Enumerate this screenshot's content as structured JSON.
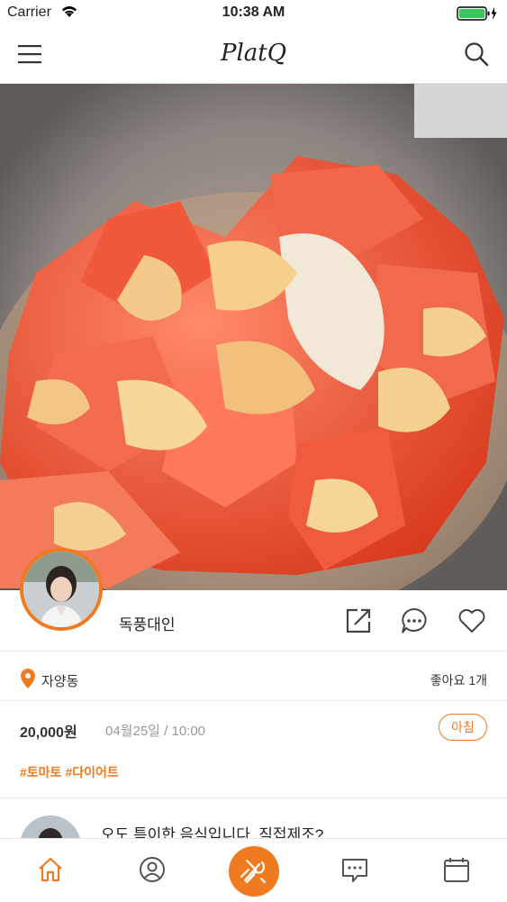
{
  "status_bar": {
    "carrier": "Carrier",
    "time": "10:38 AM"
  },
  "nav": {
    "logo": "PlatQ",
    "menu_icon": "hamburger-menu-icon",
    "search_icon": "search-icon"
  },
  "post": {
    "username": "독풍대인",
    "location": "자양동",
    "likes": "좋아요 1개",
    "price": "20,000원",
    "datetime": "04월25일 / 10:00",
    "meal": "아침",
    "tags": [
      "#토마토",
      "#다이어트"
    ],
    "actions": [
      "share-icon",
      "comment-icon",
      "heart-icon"
    ]
  },
  "comment": {
    "text": "오도 특이한 음식입니다. 직접제조?"
  },
  "tabs": [
    "home-icon",
    "profile-icon",
    "food-icon",
    "message-icon",
    "calendar-icon"
  ],
  "colors": {
    "accent": "#f07a20"
  }
}
